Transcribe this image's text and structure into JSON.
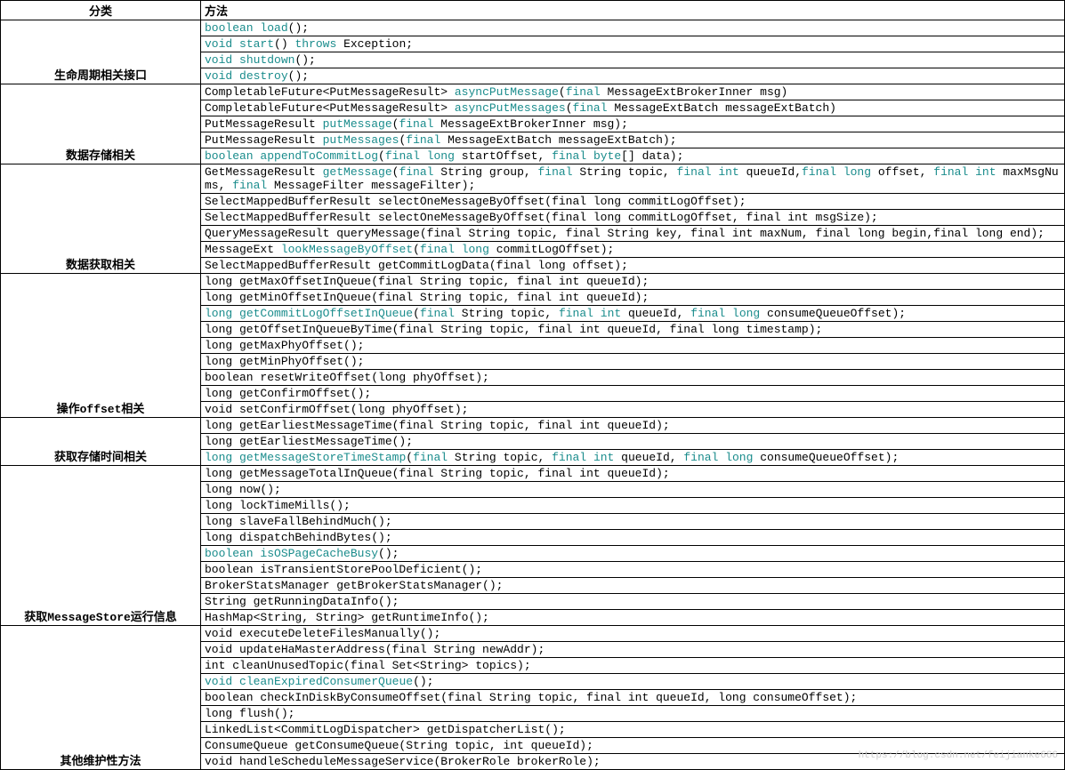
{
  "headers": {
    "col1": "分类",
    "col2": "方法"
  },
  "groups": [
    {
      "cat": "生命周期相关接口",
      "rows": [
        {
          "segs": [
            {
              "t": "boolean",
              "k": 1
            },
            {
              "t": " "
            },
            {
              "t": "load",
              "k": 1
            },
            {
              "t": "();"
            }
          ]
        },
        {
          "segs": [
            {
              "t": "void",
              "k": 1
            },
            {
              "t": " "
            },
            {
              "t": "start",
              "k": 1
            },
            {
              "t": "() "
            },
            {
              "t": "throws",
              "k": 1
            },
            {
              "t": " Exception;"
            }
          ]
        },
        {
          "segs": [
            {
              "t": "void",
              "k": 1
            },
            {
              "t": " "
            },
            {
              "t": "shutdown",
              "k": 1
            },
            {
              "t": "();"
            }
          ]
        },
        {
          "segs": [
            {
              "t": "void",
              "k": 1
            },
            {
              "t": " "
            },
            {
              "t": "destroy",
              "k": 1
            },
            {
              "t": "();"
            }
          ]
        }
      ]
    },
    {
      "cat": "数据存储相关",
      "rows": [
        {
          "segs": [
            {
              "t": "CompletableFuture<PutMessageResult> "
            },
            {
              "t": "asyncPutMessage",
              "k": 1
            },
            {
              "t": "("
            },
            {
              "t": "final",
              "k": 1
            },
            {
              "t": " MessageExtBrokerInner msg)"
            }
          ]
        },
        {
          "segs": [
            {
              "t": "CompletableFuture<PutMessageResult> "
            },
            {
              "t": "asyncPutMessages",
              "k": 1
            },
            {
              "t": "("
            },
            {
              "t": "final",
              "k": 1
            },
            {
              "t": " MessageExtBatch messageExtBatch)"
            }
          ]
        },
        {
          "segs": [
            {
              "t": "PutMessageResult "
            },
            {
              "t": "putMessage",
              "k": 1
            },
            {
              "t": "("
            },
            {
              "t": "final",
              "k": 1
            },
            {
              "t": " MessageExtBrokerInner msg);"
            }
          ]
        },
        {
          "segs": [
            {
              "t": "PutMessageResult "
            },
            {
              "t": "putMessages",
              "k": 1
            },
            {
              "t": "("
            },
            {
              "t": "final",
              "k": 1
            },
            {
              "t": " MessageExtBatch messageExtBatch);"
            }
          ]
        },
        {
          "segs": [
            {
              "t": "boolean",
              "k": 1
            },
            {
              "t": " "
            },
            {
              "t": "appendToCommitLog",
              "k": 1
            },
            {
              "t": "("
            },
            {
              "t": "final",
              "k": 1
            },
            {
              "t": " "
            },
            {
              "t": "long",
              "k": 1
            },
            {
              "t": " startOffset, "
            },
            {
              "t": "final",
              "k": 1
            },
            {
              "t": " "
            },
            {
              "t": "byte",
              "k": 1
            },
            {
              "t": "[] data);"
            }
          ]
        }
      ]
    },
    {
      "cat": "数据获取相关",
      "rows": [
        {
          "segs": [
            {
              "t": "GetMessageResult "
            },
            {
              "t": "getMessage",
              "k": 1
            },
            {
              "t": "("
            },
            {
              "t": "final",
              "k": 1
            },
            {
              "t": " String group, "
            },
            {
              "t": "final",
              "k": 1
            },
            {
              "t": " String topic, "
            },
            {
              "t": "final",
              "k": 1
            },
            {
              "t": " "
            },
            {
              "t": "int",
              "k": 1
            },
            {
              "t": " queueId,"
            },
            {
              "t": "final",
              "k": 1
            },
            {
              "t": " "
            },
            {
              "t": "long",
              "k": 1
            },
            {
              "t": " offset, "
            },
            {
              "t": "final",
              "k": 1
            },
            {
              "t": " "
            },
            {
              "t": "int",
              "k": 1
            },
            {
              "t": " maxMsgNums, "
            },
            {
              "t": "final",
              "k": 1
            },
            {
              "t": " MessageFilter messageFilter);"
            }
          ]
        },
        {
          "segs": [
            {
              "t": "SelectMappedBufferResult selectOneMessageByOffset(final long commitLogOffset);"
            }
          ]
        },
        {
          "segs": [
            {
              "t": "SelectMappedBufferResult selectOneMessageByOffset(final long commitLogOffset, final int msgSize);"
            }
          ]
        },
        {
          "segs": [
            {
              "t": "QueryMessageResult queryMessage(final String topic, final String key, final int maxNum, final long begin,final long end);"
            }
          ]
        },
        {
          "segs": [
            {
              "t": "MessageExt "
            },
            {
              "t": "lookMessageByOffset",
              "k": 1
            },
            {
              "t": "("
            },
            {
              "t": "final",
              "k": 1
            },
            {
              "t": " "
            },
            {
              "t": "long",
              "k": 1
            },
            {
              "t": " commitLogOffset);"
            }
          ]
        },
        {
          "segs": [
            {
              "t": "SelectMappedBufferResult getCommitLogData(final long offset);"
            }
          ]
        }
      ]
    },
    {
      "cat": "操作offset相关",
      "rows": [
        {
          "segs": [
            {
              "t": "long getMaxOffsetInQueue(final String topic, final int queueId);"
            }
          ]
        },
        {
          "segs": [
            {
              "t": "long getMinOffsetInQueue(final String topic, final int queueId);"
            }
          ]
        },
        {
          "segs": [
            {
              "t": "long",
              "k": 1
            },
            {
              "t": " "
            },
            {
              "t": "getCommitLogOffsetInQueue",
              "k": 1
            },
            {
              "t": "("
            },
            {
              "t": "final",
              "k": 1
            },
            {
              "t": " String topic, "
            },
            {
              "t": "final",
              "k": 1
            },
            {
              "t": " "
            },
            {
              "t": "int",
              "k": 1
            },
            {
              "t": " queueId, "
            },
            {
              "t": "final",
              "k": 1
            },
            {
              "t": " "
            },
            {
              "t": "long",
              "k": 1
            },
            {
              "t": " consumeQueueOffset);"
            }
          ]
        },
        {
          "segs": [
            {
              "t": "long getOffsetInQueueByTime(final String topic, final int queueId, final long timestamp);"
            }
          ]
        },
        {
          "segs": [
            {
              "t": "long getMaxPhyOffset();"
            }
          ]
        },
        {
          "segs": [
            {
              "t": "long getMinPhyOffset();"
            }
          ]
        },
        {
          "segs": [
            {
              "t": "boolean resetWriteOffset(long phyOffset);"
            }
          ]
        },
        {
          "segs": [
            {
              "t": "long getConfirmOffset();"
            }
          ]
        },
        {
          "segs": [
            {
              "t": "void setConfirmOffset(long phyOffset);"
            }
          ]
        }
      ]
    },
    {
      "cat": "获取存储时间相关",
      "rows": [
        {
          "segs": [
            {
              "t": "long getEarliestMessageTime(final String topic, final int queueId);"
            }
          ]
        },
        {
          "segs": [
            {
              "t": "long getEarliestMessageTime();"
            }
          ]
        },
        {
          "segs": [
            {
              "t": "long",
              "k": 1
            },
            {
              "t": " "
            },
            {
              "t": "getMessageStoreTimeStamp",
              "k": 1
            },
            {
              "t": "("
            },
            {
              "t": "final",
              "k": 1
            },
            {
              "t": " String topic, "
            },
            {
              "t": "final",
              "k": 1
            },
            {
              "t": " "
            },
            {
              "t": "int",
              "k": 1
            },
            {
              "t": " queueId, "
            },
            {
              "t": "final",
              "k": 1
            },
            {
              "t": " "
            },
            {
              "t": "long",
              "k": 1
            },
            {
              "t": " consumeQueueOffset);"
            }
          ]
        }
      ]
    },
    {
      "cat": "获取MessageStore运行信息",
      "rows": [
        {
          "segs": [
            {
              "t": "long getMessageTotalInQueue(final String topic, final int queueId);"
            }
          ]
        },
        {
          "segs": [
            {
              "t": "long now();"
            }
          ]
        },
        {
          "segs": [
            {
              "t": "long lockTimeMills();"
            }
          ]
        },
        {
          "segs": [
            {
              "t": "long slaveFallBehindMuch();"
            }
          ]
        },
        {
          "segs": [
            {
              "t": "long dispatchBehindBytes();"
            }
          ]
        },
        {
          "segs": [
            {
              "t": "boolean",
              "k": 1
            },
            {
              "t": " "
            },
            {
              "t": "isOSPageCacheBusy",
              "k": 1
            },
            {
              "t": "();"
            }
          ]
        },
        {
          "segs": [
            {
              "t": "boolean isTransientStorePoolDeficient();"
            }
          ]
        },
        {
          "segs": [
            {
              "t": "BrokerStatsManager getBrokerStatsManager();"
            }
          ]
        },
        {
          "segs": [
            {
              "t": "String getRunningDataInfo();"
            }
          ]
        },
        {
          "segs": [
            {
              "t": "HashMap<String, String> getRuntimeInfo();"
            }
          ]
        }
      ]
    },
    {
      "cat": "其他维护性方法",
      "rows": [
        {
          "segs": [
            {
              "t": "void executeDeleteFilesManually();"
            }
          ]
        },
        {
          "segs": [
            {
              "t": "void updateHaMasterAddress(final String newAddr);"
            }
          ]
        },
        {
          "segs": [
            {
              "t": "int cleanUnusedTopic(final Set<String> topics);"
            }
          ]
        },
        {
          "segs": [
            {
              "t": "void",
              "k": 1
            },
            {
              "t": " "
            },
            {
              "t": "cleanExpiredConsumerQueue",
              "k": 1
            },
            {
              "t": "();"
            }
          ]
        },
        {
          "segs": [
            {
              "t": "boolean checkInDiskByConsumeOffset(final String topic, final int queueId, long consumeOffset);"
            }
          ]
        },
        {
          "segs": [
            {
              "t": "long flush();"
            }
          ]
        },
        {
          "segs": [
            {
              "t": "LinkedList<CommitLogDispatcher> getDispatcherList();"
            }
          ]
        },
        {
          "segs": [
            {
              "t": "ConsumeQueue getConsumeQueue(String topic, int queueId);"
            }
          ]
        },
        {
          "segs": [
            {
              "t": "void handleScheduleMessageService(BrokerRole brokerRole);"
            }
          ]
        }
      ]
    }
  ],
  "watermark": "https://blog.csdn.net/feijianke666"
}
